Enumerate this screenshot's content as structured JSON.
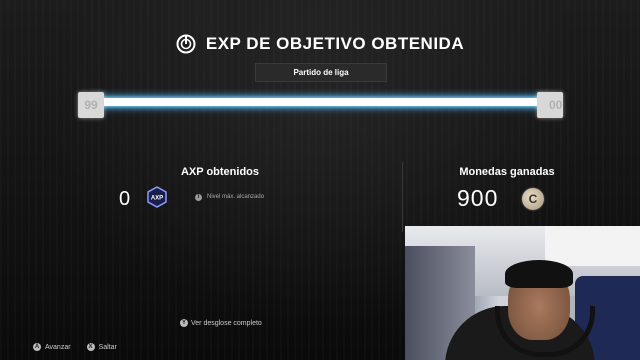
{
  "header": {
    "title": "EXP DE OBJETIVO OBTENIDA",
    "subtitle": "Partido de liga"
  },
  "progress": {
    "level_start": "99",
    "level_end_visible": "00",
    "fill_fraction": 1.0,
    "bar_color": "#4aa6d8"
  },
  "axp": {
    "label": "AXP obtenidos",
    "value": "0",
    "badge_text": "AXP",
    "info_text": "Nivel máx. alcanzado"
  },
  "coins": {
    "label": "Monedas ganadas",
    "value": "900",
    "icon_text": "C"
  },
  "breakdown": {
    "button": "Y",
    "label": "Ver desglose completo"
  },
  "footer": {
    "advance_button": "A",
    "advance_label": "Avanzar",
    "skip_button": "X",
    "skip_label": "Saltar"
  },
  "icons": {
    "title_icon": "objective-target-icon",
    "coin_icon": "coin-icon",
    "axp_icon": "axp-badge-icon",
    "info_icon": "info-icon"
  }
}
